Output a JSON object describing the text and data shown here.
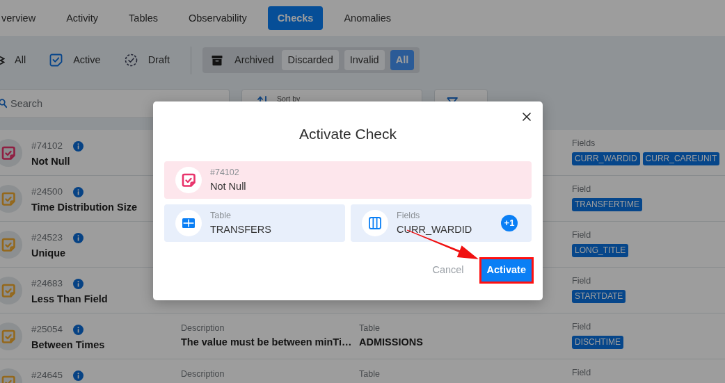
{
  "tabs": [
    {
      "label": "verview",
      "selected": false
    },
    {
      "label": "Activity",
      "selected": false
    },
    {
      "label": "Tables",
      "selected": false
    },
    {
      "label": "Observability",
      "selected": false
    },
    {
      "label": "Checks",
      "selected": true
    },
    {
      "label": "Anomalies",
      "selected": false
    }
  ],
  "status_filters": [
    {
      "label": "All",
      "kind": "all"
    },
    {
      "label": "Active",
      "kind": "active"
    },
    {
      "label": "Draft",
      "kind": "draft"
    }
  ],
  "archived_filter": {
    "label": "Archived",
    "options": [
      {
        "label": "Discarded",
        "selected": false
      },
      {
        "label": "Invalid",
        "selected": false
      },
      {
        "label": "All",
        "selected": true
      }
    ]
  },
  "search": {
    "placeholder": "Search"
  },
  "sort": {
    "label": "Sort by"
  },
  "checks": [
    {
      "id": "#74102",
      "name": "Not Null",
      "color": "#8f1f42",
      "field": {
        "label": "Fields",
        "tags": [
          "CURR_WARDID",
          "CURR_CAREUNIT"
        ]
      }
    },
    {
      "id": "#24500",
      "name": "Time Distribution Size",
      "color": "#94681c",
      "field": {
        "label": "Field",
        "tags": [
          "TRANSFERTIME"
        ]
      }
    },
    {
      "id": "#24523",
      "name": "Unique",
      "color": "#94681c",
      "field": {
        "label": "Field",
        "tags": [
          "LONG_TITLE"
        ]
      }
    },
    {
      "id": "#24683",
      "name": "Less Than Field",
      "color": "#94681c",
      "field": {
        "label": "Field",
        "tags": [
          "STARTDATE"
        ]
      }
    },
    {
      "id": "#25054",
      "name": "Between Times",
      "color": "#94681c",
      "columns": [
        {
          "label": "Description",
          "value": "The value must be between minTi…"
        },
        {
          "label": "Table",
          "value": "ADMISSIONS"
        }
      ],
      "field": {
        "label": "Field",
        "tags": [
          "DISCHTIME"
        ]
      }
    },
    {
      "id": "#24645",
      "color": "#94681c",
      "columns": [
        {
          "label": "Description"
        },
        {
          "label": "Table"
        }
      ],
      "field": {
        "label": "Field"
      }
    }
  ],
  "modal": {
    "title": "Activate Check",
    "check": {
      "id": "#74102",
      "name": "Not Null",
      "color": "#e8336b"
    },
    "table": {
      "label": "Table",
      "value": "TRANSFERS"
    },
    "fields": {
      "label": "Fields",
      "value": "CURR_WARDID",
      "more": "+1"
    },
    "buttons": [
      {
        "label": "Cancel",
        "kind": "link",
        "highlighted": false
      },
      {
        "label": "Activate",
        "kind": "primary",
        "highlighted": true
      }
    ],
    "pointer_arrow": true
  }
}
